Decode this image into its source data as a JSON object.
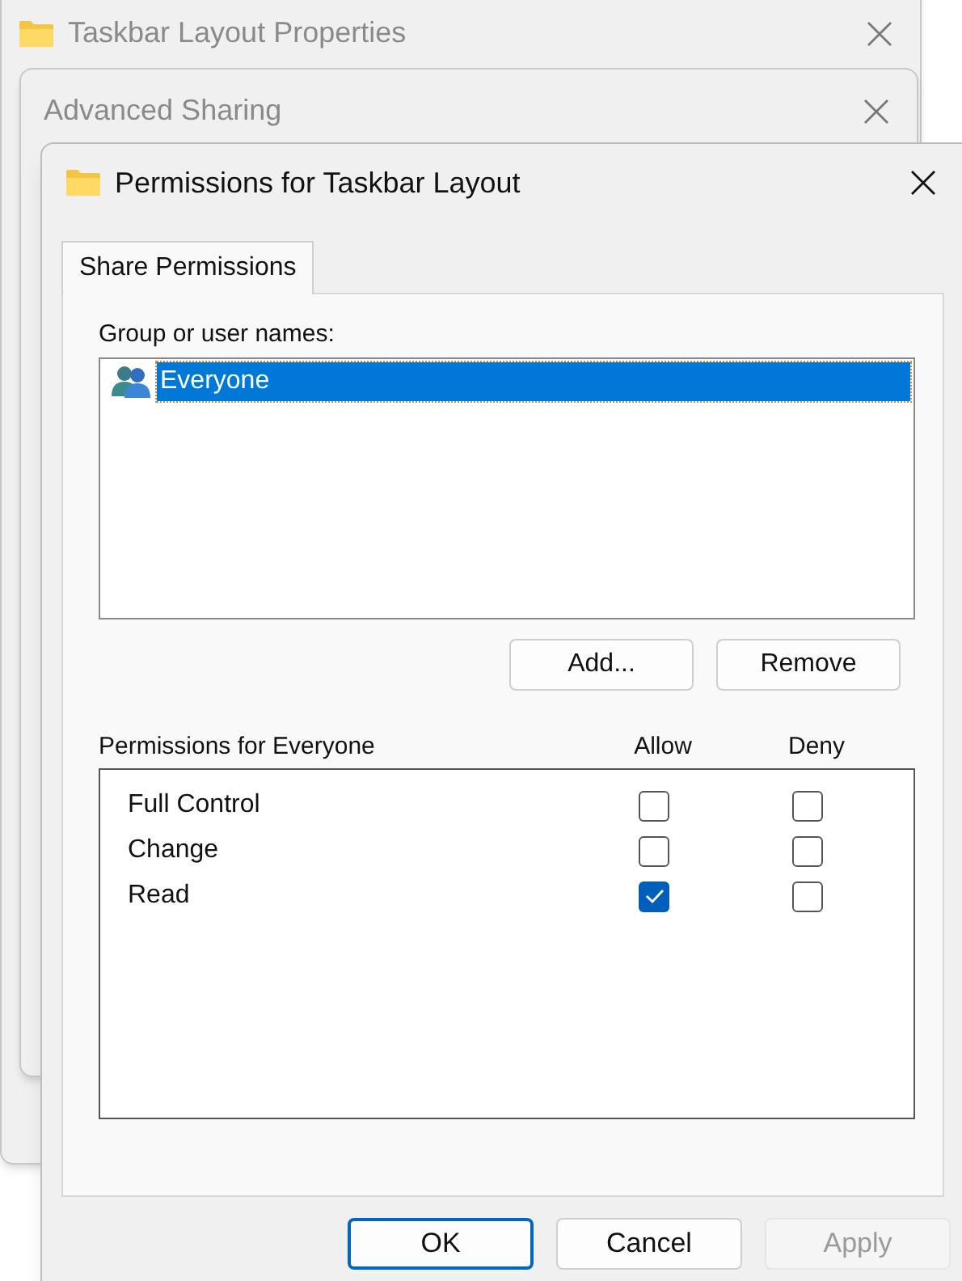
{
  "background_windows": [
    {
      "title": "Taskbar Layout Properties",
      "kind": "folder"
    },
    {
      "title": "Advanced Sharing",
      "kind": "plain"
    }
  ],
  "dialog": {
    "title": "Permissions for Taskbar Layout",
    "tabs": [
      {
        "label": "Share Permissions",
        "selected": true
      }
    ],
    "group_label": "Group or user names:",
    "users": [
      {
        "name": "Everyone",
        "selected": true
      }
    ],
    "user_buttons": [
      "Add...",
      "Remove"
    ],
    "permissions_label": "Permissions for Everyone",
    "columns": [
      "Allow",
      "Deny"
    ],
    "permissions": [
      {
        "name": "Full Control",
        "allow": false,
        "deny": false
      },
      {
        "name": "Change",
        "allow": false,
        "deny": false
      },
      {
        "name": "Read",
        "allow": true,
        "deny": false
      }
    ],
    "buttons": [
      {
        "label": "OK",
        "default": true,
        "disabled": false
      },
      {
        "label": "Cancel",
        "default": false,
        "disabled": false
      },
      {
        "label": "Apply",
        "default": false,
        "disabled": true
      }
    ]
  }
}
